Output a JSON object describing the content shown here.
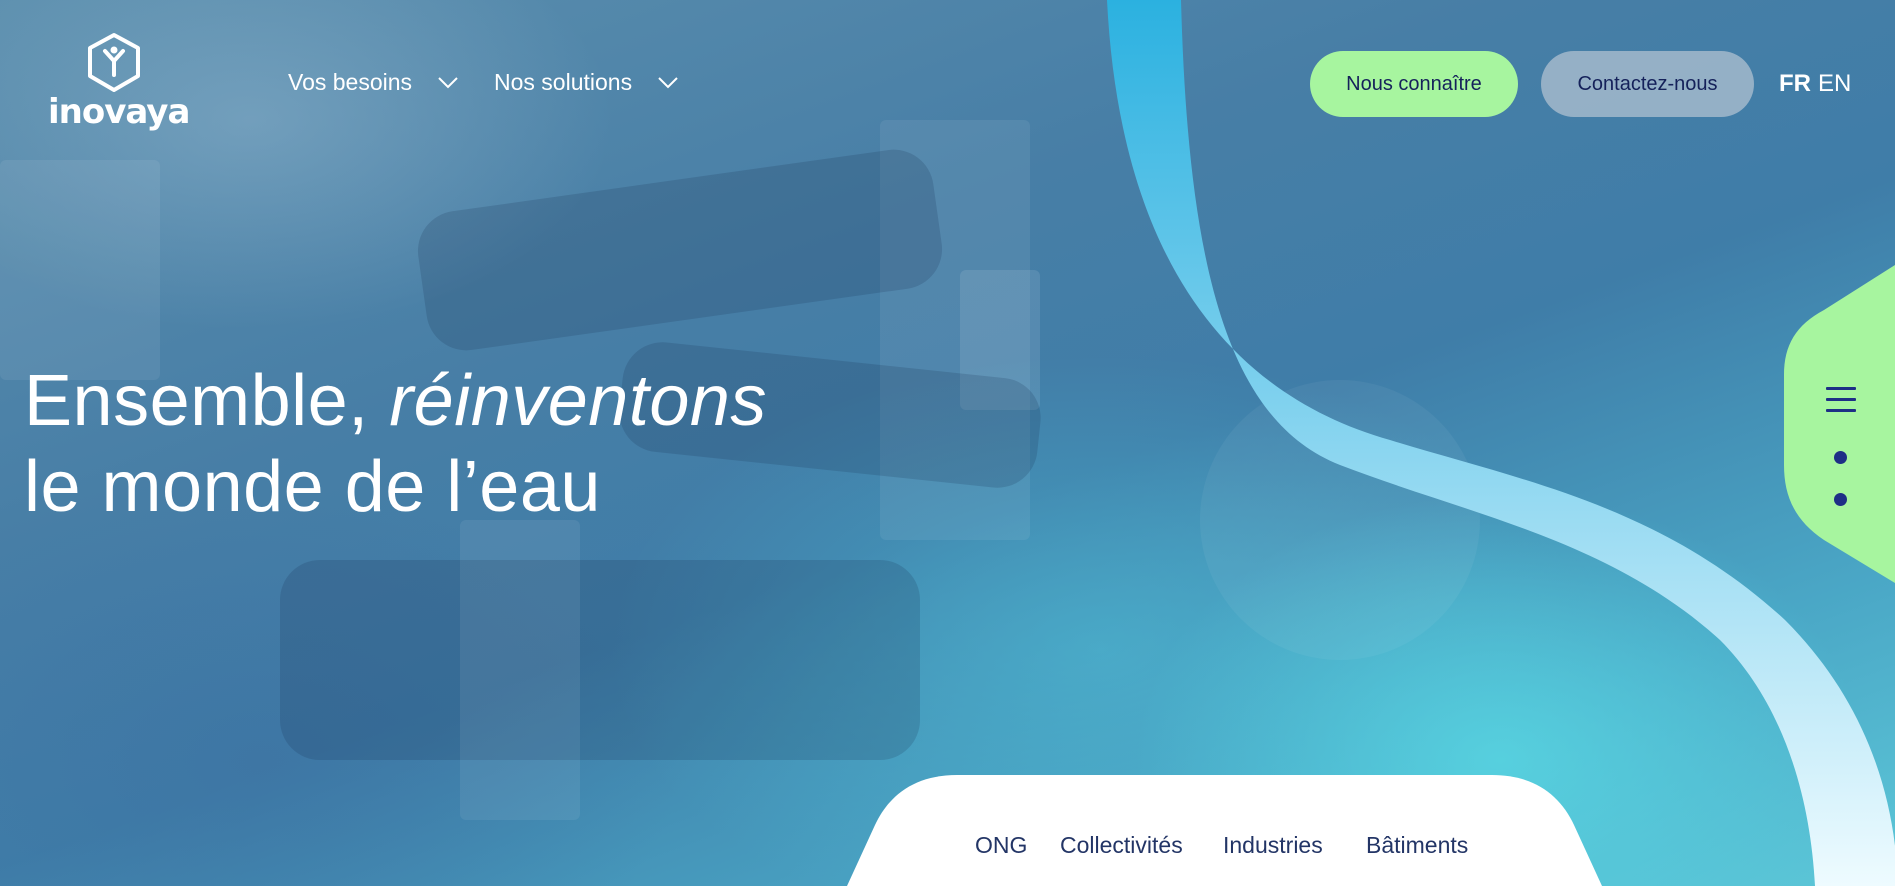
{
  "header": {
    "logo_text": "inovaya",
    "nav": [
      {
        "label": "Vos besoins"
      },
      {
        "label": "Nos solutions"
      }
    ],
    "cta_primary": "Nous connaître",
    "cta_secondary": "Contactez-nous",
    "languages": [
      {
        "code": "FR",
        "active": true
      },
      {
        "code": "EN",
        "active": false
      }
    ]
  },
  "hero": {
    "headline_start": "Ensemble, ",
    "headline_emphasis": "réinventons",
    "headline_end": "le monde de l’eau"
  },
  "side_nav": {
    "icon": "hamburger-menu-icon",
    "dot_count": 2
  },
  "segments": {
    "tabs": [
      "ONG",
      "Collectivités",
      "Industries",
      "Bâtiments"
    ]
  },
  "colors": {
    "accent_green": "#a7f59f",
    "navy": "#15215a",
    "curve_top": "#2bb1e0",
    "curve_bottom": "#eefbff"
  }
}
